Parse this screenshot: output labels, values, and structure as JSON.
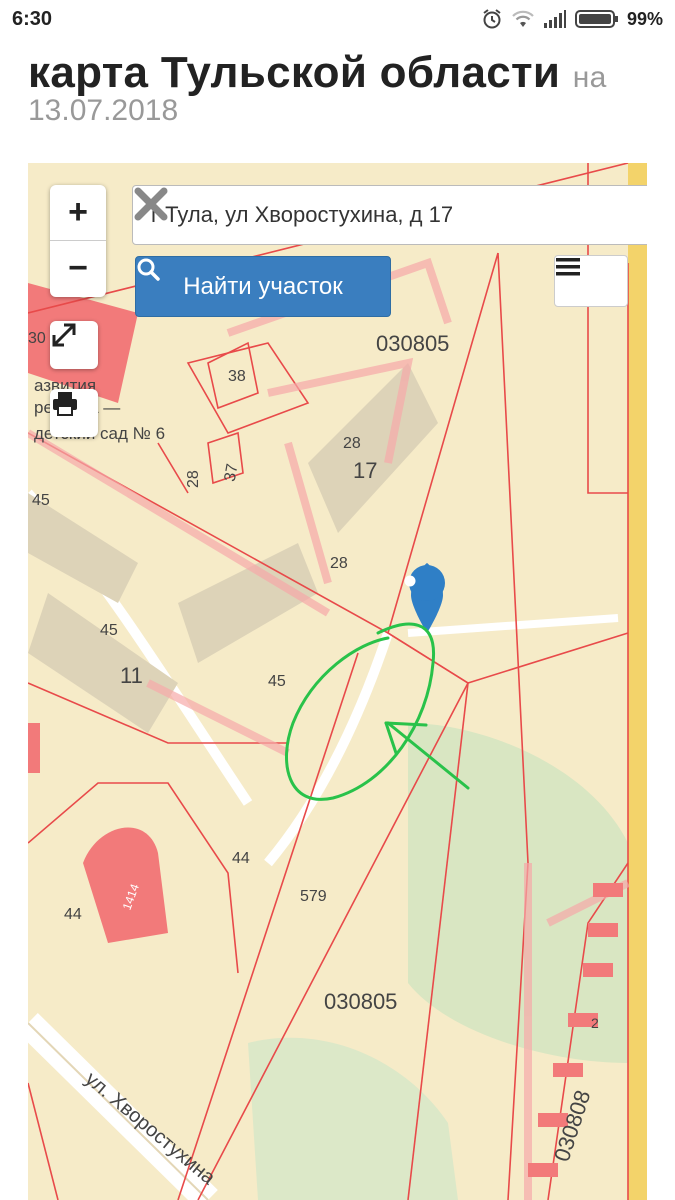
{
  "status_bar": {
    "time": "6:30",
    "battery": "99%",
    "icons": [
      "alarm-icon",
      "wifi-icon",
      "signal-icon",
      "battery-icon"
    ]
  },
  "heading": {
    "title": "карта Тульской области",
    "suffix": "на",
    "date": "13.07.2018"
  },
  "map": {
    "search": {
      "value": "г Тула, ул Хворостухина, д 17",
      "clear_icon": "close-icon"
    },
    "find_button": {
      "label": "Найти участок",
      "icon": "search-icon"
    },
    "controls": {
      "zoom_in": "+",
      "zoom_out": "−",
      "fullscreen_icon": "expand-icon",
      "print_icon": "print-icon",
      "menu_icon": "menu-icon"
    },
    "labels": {
      "quarter_top": "030805",
      "quarter_mid": "030805",
      "quarter_bottom": "030808",
      "plot_38": "38",
      "plot_28a": "28",
      "plot_28b": "28",
      "plot_28c": "28",
      "plot_37": "37",
      "plot_45a": "45",
      "plot_45b": "45",
      "plot_45c": "45",
      "plot_44a": "44",
      "plot_44b": "44",
      "plot_579": "579",
      "plot_30": "30",
      "plot_2": "2",
      "plot_1414": "1414",
      "house_11": "11",
      "house_17": "17",
      "org_line1": "азвития",
      "org_line2": "ребёнка —",
      "org_line3": "детский сад № 6",
      "street": "ул. Хворостухина"
    },
    "colors": {
      "boundary": "#e84a4a",
      "parcel_fill": "#f7c6c6",
      "background": "#f6ebc8",
      "marker": "#2f7fc6",
      "annotation": "#29c24a"
    }
  }
}
